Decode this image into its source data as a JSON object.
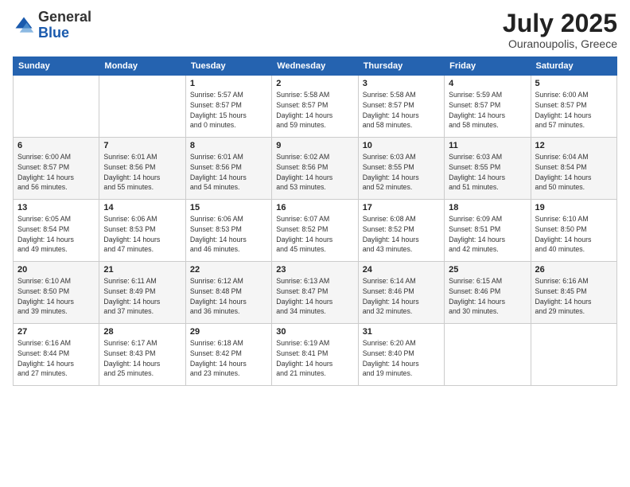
{
  "header": {
    "logo_general": "General",
    "logo_blue": "Blue",
    "title": "July 2025",
    "location": "Ouranoupolis, Greece"
  },
  "weekdays": [
    "Sunday",
    "Monday",
    "Tuesday",
    "Wednesday",
    "Thursday",
    "Friday",
    "Saturday"
  ],
  "weeks": [
    [
      {
        "day": "",
        "detail": ""
      },
      {
        "day": "",
        "detail": ""
      },
      {
        "day": "1",
        "detail": "Sunrise: 5:57 AM\nSunset: 8:57 PM\nDaylight: 15 hours\nand 0 minutes."
      },
      {
        "day": "2",
        "detail": "Sunrise: 5:58 AM\nSunset: 8:57 PM\nDaylight: 14 hours\nand 59 minutes."
      },
      {
        "day": "3",
        "detail": "Sunrise: 5:58 AM\nSunset: 8:57 PM\nDaylight: 14 hours\nand 58 minutes."
      },
      {
        "day": "4",
        "detail": "Sunrise: 5:59 AM\nSunset: 8:57 PM\nDaylight: 14 hours\nand 58 minutes."
      },
      {
        "day": "5",
        "detail": "Sunrise: 6:00 AM\nSunset: 8:57 PM\nDaylight: 14 hours\nand 57 minutes."
      }
    ],
    [
      {
        "day": "6",
        "detail": "Sunrise: 6:00 AM\nSunset: 8:57 PM\nDaylight: 14 hours\nand 56 minutes."
      },
      {
        "day": "7",
        "detail": "Sunrise: 6:01 AM\nSunset: 8:56 PM\nDaylight: 14 hours\nand 55 minutes."
      },
      {
        "day": "8",
        "detail": "Sunrise: 6:01 AM\nSunset: 8:56 PM\nDaylight: 14 hours\nand 54 minutes."
      },
      {
        "day": "9",
        "detail": "Sunrise: 6:02 AM\nSunset: 8:56 PM\nDaylight: 14 hours\nand 53 minutes."
      },
      {
        "day": "10",
        "detail": "Sunrise: 6:03 AM\nSunset: 8:55 PM\nDaylight: 14 hours\nand 52 minutes."
      },
      {
        "day": "11",
        "detail": "Sunrise: 6:03 AM\nSunset: 8:55 PM\nDaylight: 14 hours\nand 51 minutes."
      },
      {
        "day": "12",
        "detail": "Sunrise: 6:04 AM\nSunset: 8:54 PM\nDaylight: 14 hours\nand 50 minutes."
      }
    ],
    [
      {
        "day": "13",
        "detail": "Sunrise: 6:05 AM\nSunset: 8:54 PM\nDaylight: 14 hours\nand 49 minutes."
      },
      {
        "day": "14",
        "detail": "Sunrise: 6:06 AM\nSunset: 8:53 PM\nDaylight: 14 hours\nand 47 minutes."
      },
      {
        "day": "15",
        "detail": "Sunrise: 6:06 AM\nSunset: 8:53 PM\nDaylight: 14 hours\nand 46 minutes."
      },
      {
        "day": "16",
        "detail": "Sunrise: 6:07 AM\nSunset: 8:52 PM\nDaylight: 14 hours\nand 45 minutes."
      },
      {
        "day": "17",
        "detail": "Sunrise: 6:08 AM\nSunset: 8:52 PM\nDaylight: 14 hours\nand 43 minutes."
      },
      {
        "day": "18",
        "detail": "Sunrise: 6:09 AM\nSunset: 8:51 PM\nDaylight: 14 hours\nand 42 minutes."
      },
      {
        "day": "19",
        "detail": "Sunrise: 6:10 AM\nSunset: 8:50 PM\nDaylight: 14 hours\nand 40 minutes."
      }
    ],
    [
      {
        "day": "20",
        "detail": "Sunrise: 6:10 AM\nSunset: 8:50 PM\nDaylight: 14 hours\nand 39 minutes."
      },
      {
        "day": "21",
        "detail": "Sunrise: 6:11 AM\nSunset: 8:49 PM\nDaylight: 14 hours\nand 37 minutes."
      },
      {
        "day": "22",
        "detail": "Sunrise: 6:12 AM\nSunset: 8:48 PM\nDaylight: 14 hours\nand 36 minutes."
      },
      {
        "day": "23",
        "detail": "Sunrise: 6:13 AM\nSunset: 8:47 PM\nDaylight: 14 hours\nand 34 minutes."
      },
      {
        "day": "24",
        "detail": "Sunrise: 6:14 AM\nSunset: 8:46 PM\nDaylight: 14 hours\nand 32 minutes."
      },
      {
        "day": "25",
        "detail": "Sunrise: 6:15 AM\nSunset: 8:46 PM\nDaylight: 14 hours\nand 30 minutes."
      },
      {
        "day": "26",
        "detail": "Sunrise: 6:16 AM\nSunset: 8:45 PM\nDaylight: 14 hours\nand 29 minutes."
      }
    ],
    [
      {
        "day": "27",
        "detail": "Sunrise: 6:16 AM\nSunset: 8:44 PM\nDaylight: 14 hours\nand 27 minutes."
      },
      {
        "day": "28",
        "detail": "Sunrise: 6:17 AM\nSunset: 8:43 PM\nDaylight: 14 hours\nand 25 minutes."
      },
      {
        "day": "29",
        "detail": "Sunrise: 6:18 AM\nSunset: 8:42 PM\nDaylight: 14 hours\nand 23 minutes."
      },
      {
        "day": "30",
        "detail": "Sunrise: 6:19 AM\nSunset: 8:41 PM\nDaylight: 14 hours\nand 21 minutes."
      },
      {
        "day": "31",
        "detail": "Sunrise: 6:20 AM\nSunset: 8:40 PM\nDaylight: 14 hours\nand 19 minutes."
      },
      {
        "day": "",
        "detail": ""
      },
      {
        "day": "",
        "detail": ""
      }
    ]
  ]
}
